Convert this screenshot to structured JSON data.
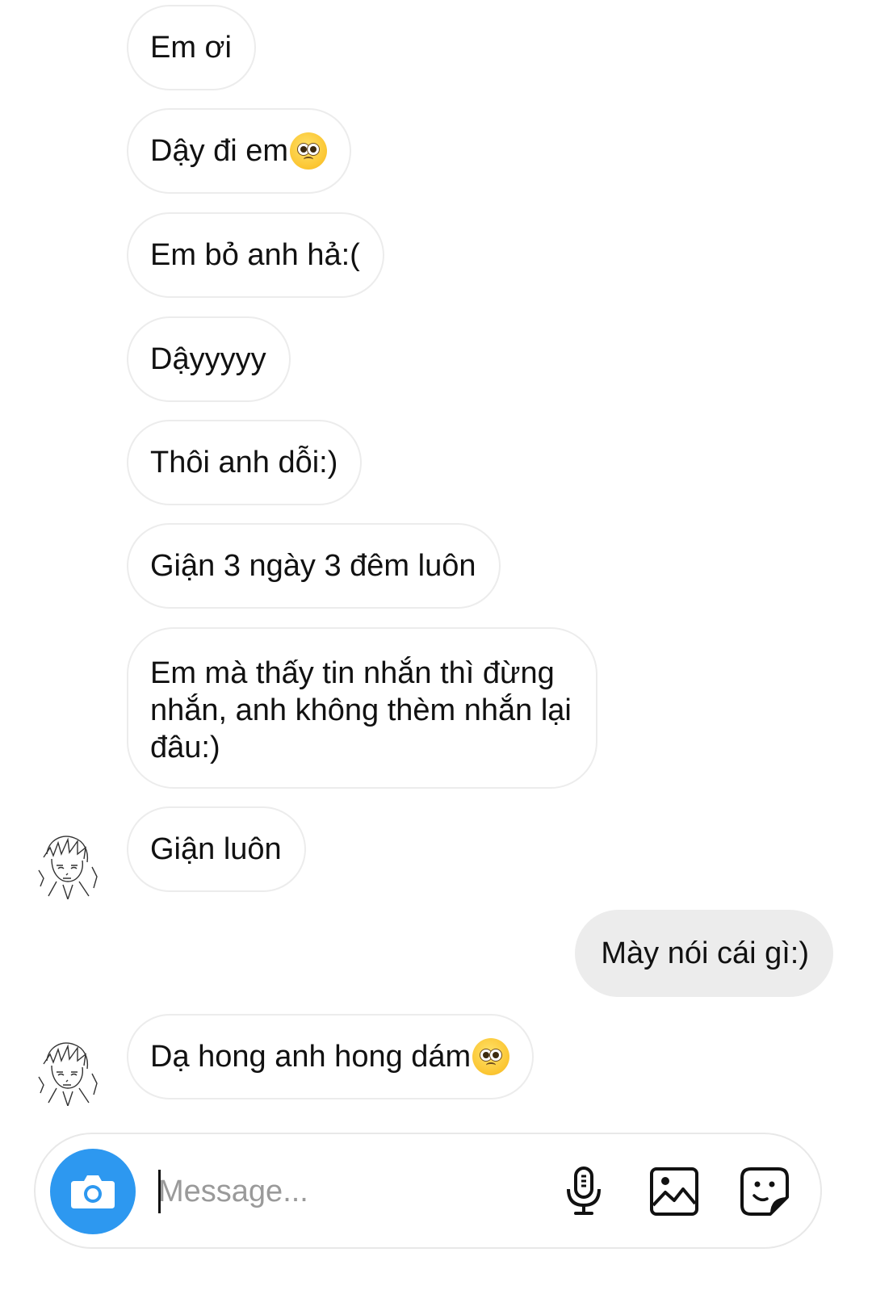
{
  "messages": [
    {
      "from": "them",
      "text": "Em ơi"
    },
    {
      "from": "them",
      "text": "Dậy đi em",
      "emoji": "pleading-face-emoji"
    },
    {
      "from": "them",
      "text": "Em bỏ anh hả:("
    },
    {
      "from": "them",
      "text": "Dậyyyyy"
    },
    {
      "from": "them",
      "text": "Thôi anh dỗi:)"
    },
    {
      "from": "them",
      "text": "Giận 3 ngày 3 đêm luôn"
    },
    {
      "from": "them",
      "text": "Em mà thấy tin nhắn thì đừng nhắn, anh không thèm nhắn lại đâu:)"
    },
    {
      "from": "them",
      "text": "Giận luôn",
      "avatar": true
    },
    {
      "from": "me",
      "text": "Mày nói cái gì:)"
    },
    {
      "from": "them",
      "text": "Dạ hong anh hong dám",
      "emoji": "pleading-face-emoji",
      "avatar": true
    }
  ],
  "composer": {
    "placeholder": "Message...",
    "icons": [
      "camera-icon",
      "microphone-icon",
      "gallery-icon",
      "sticker-icon"
    ]
  },
  "colors": {
    "incoming_bubble_border": "#ececec",
    "outgoing_bubble_bg": "#ececec",
    "camera_button": "#2d98f0"
  }
}
